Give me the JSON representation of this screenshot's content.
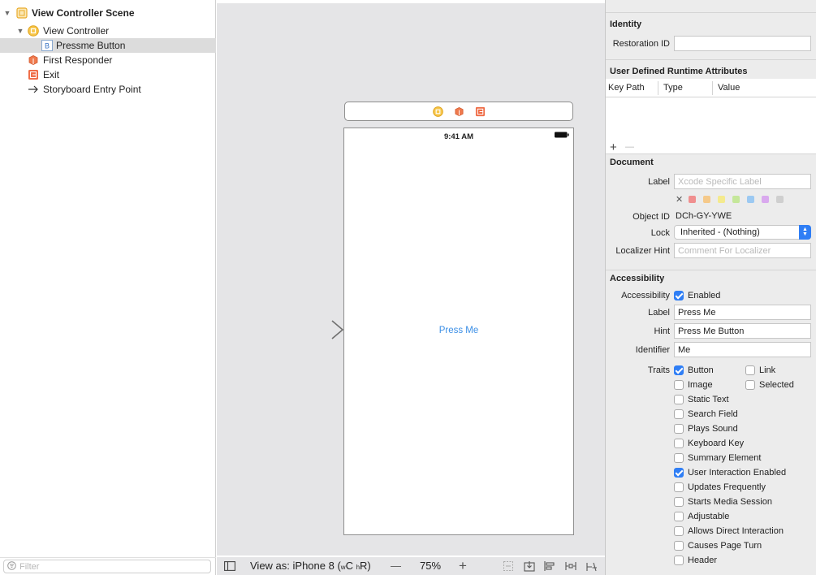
{
  "outline": {
    "items": [
      {
        "label": "View Controller Scene",
        "bold": true
      },
      {
        "label": "View Controller"
      },
      {
        "label": "Pressme Button"
      },
      {
        "label": "First Responder"
      },
      {
        "label": "Exit"
      },
      {
        "label": "Storyboard Entry Point"
      }
    ],
    "filter_placeholder": "Filter"
  },
  "canvas": {
    "status_time": "9:41 AM",
    "button_title": "Press Me"
  },
  "bottom_bar": {
    "view_as_prefix": "View as: iPhone 8 (",
    "size_w": "w",
    "size_w_val": "C ",
    "size_h": "h",
    "size_h_val": "R",
    "view_as_suffix": ")",
    "zoom": "75%",
    "zoom_out": "—",
    "zoom_in": "+"
  },
  "inspector": {
    "identity": {
      "heading": "Identity",
      "restoration_id_label": "Restoration ID",
      "restoration_id_value": ""
    },
    "runtime_attrs": {
      "heading": "User Defined Runtime Attributes",
      "col_key_path": "Key Path",
      "col_type": "Type",
      "col_value": "Value",
      "add": "+",
      "remove": "—"
    },
    "document": {
      "heading": "Document",
      "label_label": "Label",
      "label_placeholder": "Xcode Specific Label",
      "clear_glyph": "✕",
      "object_id_label": "Object ID",
      "object_id_value": "DCh-GY-YWE",
      "lock_label": "Lock",
      "lock_value": "Inherited - (Nothing)",
      "localizer_hint_label": "Localizer Hint",
      "localizer_hint_placeholder": "Comment For Localizer",
      "swatch_colors": [
        "#f08f8f",
        "#f5c98a",
        "#f4ea8e",
        "#c5e79a",
        "#9cc9f2",
        "#d9a9ee",
        "#cfcfcf"
      ]
    },
    "accessibility": {
      "heading": "Accessibility",
      "accessibility_label": "Accessibility",
      "enabled_label": "Enabled",
      "enabled": true,
      "label_label": "Label",
      "label_value": "Press Me",
      "hint_label": "Hint",
      "hint_value": "Press Me Button",
      "identifier_label": "Identifier",
      "identifier_value": "Me",
      "traits_label": "Traits",
      "traits": [
        {
          "label": "Button",
          "checked": true
        },
        {
          "label": "Link",
          "checked": false
        },
        {
          "label": "Image",
          "checked": false
        },
        {
          "label": "Selected",
          "checked": false
        },
        {
          "label": "Static Text",
          "checked": false
        },
        {
          "label": "Search Field",
          "checked": false
        },
        {
          "label": "Plays Sound",
          "checked": false
        },
        {
          "label": "Keyboard Key",
          "checked": false
        },
        {
          "label": "Summary Element",
          "checked": false
        },
        {
          "label": "User Interaction Enabled",
          "checked": true
        },
        {
          "label": "Updates Frequently",
          "checked": false
        },
        {
          "label": "Starts Media Session",
          "checked": false
        },
        {
          "label": "Adjustable",
          "checked": false
        },
        {
          "label": "Allows Direct Interaction",
          "checked": false
        },
        {
          "label": "Causes Page Turn",
          "checked": false
        },
        {
          "label": "Header",
          "checked": false
        }
      ]
    }
  },
  "colors": {
    "accent": "#2f7ef5",
    "link_text": "#3a8ee6",
    "canvas_bg": "#e5e5e7",
    "inspector_bg": "#ececec"
  }
}
